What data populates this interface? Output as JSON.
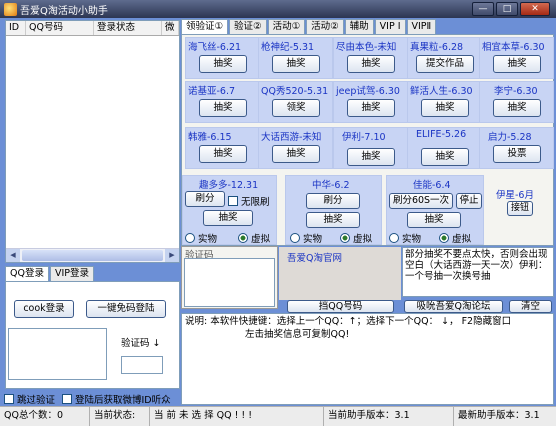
{
  "window": {
    "title": "吾爱Q淘活动小助手",
    "controls": [
      "—",
      "□",
      "✕"
    ]
  },
  "list": {
    "columns": [
      "ID",
      "QQ号码",
      "登录状态",
      "微"
    ]
  },
  "left_tabs": [
    "QQ登录",
    "VIP登录"
  ],
  "left_panel": {
    "cook_login": "cook登录",
    "one_key_login": "一键免码登陆",
    "captcha_label": "验证码 ↓",
    "skip_verify": "跳过验证",
    "after_login": "登陆后获取微博ID听众"
  },
  "top_tabs": [
    "领验证①",
    "验证②",
    "活动①",
    "活动②",
    "辅助",
    "VIP Ⅰ",
    "VIPⅡ"
  ],
  "cards": [
    {
      "label": "海飞丝-6.21",
      "button": "抽奖"
    },
    {
      "label": "枪神纪-5.31",
      "button": "抽奖"
    },
    {
      "label": "尽由本色-未知",
      "button": "抽奖"
    },
    {
      "label": "真果粒-6.28",
      "button": "提交作品"
    },
    {
      "label": "相宜本草-6.30",
      "button": "抽奖"
    },
    {
      "label": "诺基亚-6.7",
      "button": "抽奖"
    },
    {
      "label": "QQ秀520-5.31",
      "button": "领奖"
    },
    {
      "label": "jeep试驾-6.30",
      "button": "抽奖"
    },
    {
      "label": "鲜活人生-6.30",
      "button": "抽奖"
    },
    {
      "label": "李宁-6.30",
      "button": "抽奖"
    },
    {
      "label": "韩雅-6.15",
      "button": "抽奖"
    },
    {
      "label": "大话西游-未知",
      "button": "抽奖"
    },
    {
      "label": "伊利-7.10",
      "button": "抽奖"
    },
    {
      "label": "ELIFE-5.26",
      "button": "抽奖"
    },
    {
      "label": "启力-5.28",
      "button": "投票"
    }
  ],
  "group1": {
    "label": "趣多多-12.31",
    "refresh": "刷分",
    "unlimited": "无限刷",
    "draw": "抽奖",
    "real": "实物",
    "virtual": "虚拟"
  },
  "group2": {
    "label": "中华-6.2",
    "refresh": "刷分",
    "draw": "抽奖",
    "real": "实物",
    "virtual": "虚拟"
  },
  "group3": {
    "label": "佳能-6.4",
    "refresh": "刷分60S一次",
    "stop": "停止",
    "draw": "抽奖",
    "real": "实物",
    "virtual": "虚拟"
  },
  "group4": {
    "label": "伊星-6月",
    "button": "接钮"
  },
  "captcha_title": "验证码",
  "site_link": "吾爱Q淘官网",
  "message": "部分抽奖不要点太快，否则会出现空白（大话西游一天一次）伊利：一个号抽一次换号抽",
  "buttons_row": {
    "qq": "挡QQ号码",
    "forum": "吸吮吾爱Q淘论坛",
    "clear": "清空"
  },
  "log": {
    "line1": "说明:  本软件快捷键：选择上一个QQ：↑；选择下一个QQ：  ↓，    F2隐藏窗口",
    "line2": "左击抽奖信息可复制QQ!"
  },
  "status": {
    "qq_total": "QQ总个数：0",
    "state_label": "当前状态:",
    "state_value": "当  前  未  选  择  QQ ! ! !",
    "version": "当前助手版本：3.1",
    "latest": "最新助手版本：3.1"
  }
}
